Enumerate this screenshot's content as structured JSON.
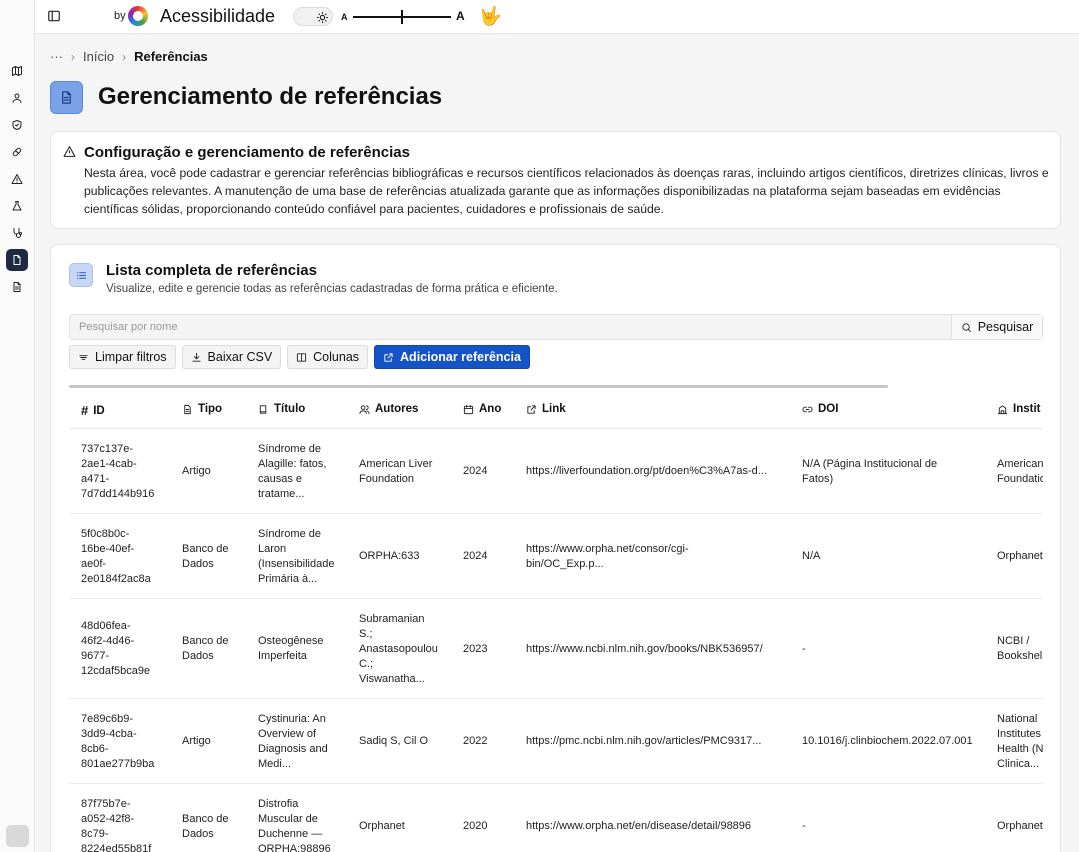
{
  "topbar": {
    "by": "by",
    "accessibility_title": "Acessibilidade",
    "font_small": "A",
    "font_large": "A",
    "font_size_level": 0.5
  },
  "breadcrumb": {
    "more": "···",
    "home": "Início",
    "current": "Referências"
  },
  "page": {
    "title": "Gerenciamento de referências"
  },
  "info": {
    "title": "Configuração e gerenciamento de referências",
    "text": "Nesta área, você pode cadastrar e gerenciar referências bibliográficas e recursos científicos relacionados às doenças raras, incluindo artigos científicos, diretrizes clínicas, livros e publicações relevantes. A manutenção de uma base de referências atualizada garante que as informações disponibilizadas na plataforma sejam baseadas em evidências científicas sólidas, proporcionando conteúdo confiável para pacientes, cuidadores e profissionais de saúde."
  },
  "list": {
    "title": "Lista completa de referências",
    "subtitle": "Visualize, edite e gerencie todas as referências cadastradas de forma prática e eficiente.",
    "search_placeholder": "Pesquisar por nome",
    "search_button": "Pesquisar",
    "toolbar": {
      "clear": "Limpar filtros",
      "download": "Baixar CSV",
      "columns": "Colunas",
      "add": "Adicionar referência"
    },
    "columns": {
      "id": "ID",
      "tipo": "Tipo",
      "titulo": "Título",
      "autores": "Autores",
      "ano": "Ano",
      "link": "Link",
      "doi": "DOI",
      "inst": "Instit"
    },
    "rows": [
      {
        "id": [
          "737c137e-",
          "2ae1-4cab-",
          "a471-",
          "7d7dd144b916"
        ],
        "tipo": [
          "Artigo"
        ],
        "titulo": [
          "Síndrome de",
          "Alagille: fatos,",
          "causas e",
          "tratame..."
        ],
        "autores": [
          "American Liver",
          "Foundation"
        ],
        "ano": "2024",
        "link": [
          "https://liverfoundation.org/pt/doen%C3%A7as-d..."
        ],
        "doi": [
          "N/A (Página Institucional de",
          "Fatos)"
        ],
        "inst": [
          "American",
          "Foundatio"
        ]
      },
      {
        "id": [
          "5f0c8b0c-",
          "16be-40ef-",
          "ae0f-",
          "2e0184f2ac8a"
        ],
        "tipo": [
          "Banco de",
          "Dados"
        ],
        "titulo": [
          "Síndrome de",
          "Laron",
          "(Insensibilidade",
          "Primária à..."
        ],
        "autores": [
          "ORPHA:633"
        ],
        "ano": "2024",
        "link": [
          "https://www.orpha.net/consor/cgi-",
          "bin/OC_Exp.p..."
        ],
        "doi": [
          "N/A"
        ],
        "inst": [
          "Orphanet"
        ]
      },
      {
        "id": [
          "48d06fea-",
          "46f2-4d46-",
          "9677-",
          "12cdaf5bca9e"
        ],
        "tipo": [
          "Banco de",
          "Dados"
        ],
        "titulo": [
          "Osteogênese",
          "Imperfeita"
        ],
        "autores": [
          "Subramanian",
          "S.;",
          "Anastasopoulou",
          "C.;",
          "Viswanatha..."
        ],
        "ano": "2023",
        "link": [
          "https://www.ncbi.nlm.nih.gov/books/NBK536957/"
        ],
        "doi": [
          "-"
        ],
        "inst": [
          "NCBI /",
          "Bookshel"
        ]
      },
      {
        "id": [
          "7e89c6b9-",
          "3dd9-4cba-",
          "8cb6-",
          "801ae277b9ba"
        ],
        "tipo": [
          "Artigo"
        ],
        "titulo": [
          "Cystinuria: An",
          "Overview of",
          "Diagnosis and",
          "Medi..."
        ],
        "autores": [
          "Sadiq S, Cil O"
        ],
        "ano": "2022",
        "link": [
          "https://pmc.ncbi.nlm.nih.gov/articles/PMC9317..."
        ],
        "doi": [
          "10.1016/j.clinbiochem.2022.07.001"
        ],
        "inst": [
          "National",
          "Institutes",
          "Health (N",
          "Clinica..."
        ]
      },
      {
        "id": [
          "87f75b7e-",
          "a052-42f8-",
          "8c79-",
          "8224ed55b81f"
        ],
        "tipo": [
          "Banco de",
          "Dados"
        ],
        "titulo": [
          "Distrofia",
          "Muscular de",
          "Duchenne —",
          "ORPHA:98896"
        ],
        "autores": [
          "Orphanet"
        ],
        "ano": "2020",
        "link": [
          "https://www.orpha.net/en/disease/detail/98896"
        ],
        "doi": [
          "-"
        ],
        "inst": [
          "Orphanet"
        ]
      }
    ]
  }
}
